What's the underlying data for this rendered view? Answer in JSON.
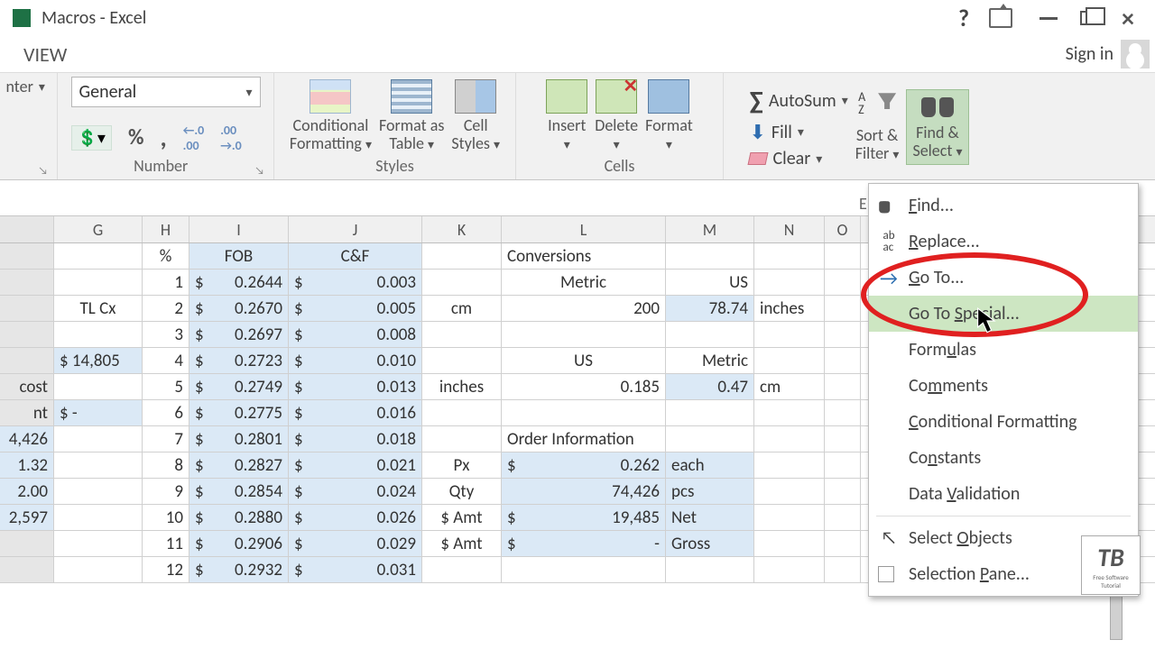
{
  "title": "Macros - Excel",
  "tabs": {
    "view": "VIEW"
  },
  "signin": "Sign in",
  "ribbon": {
    "align_stub": "nter",
    "number": {
      "combo": "General",
      "group_label": "Number",
      "pct": "%",
      "comma": ",",
      "dec_inc": ".0₀₀",
      "dec_dec": ".00₃"
    },
    "styles": {
      "cond": "Conditional\nFormatting",
      "fmt_table": "Format as\nTable",
      "cell_styles": "Cell\nStyles",
      "group_label": "Styles"
    },
    "cells": {
      "insert": "Insert",
      "delete": "Delete",
      "format": "Format",
      "group_label": "Cells"
    },
    "editing": {
      "autosum": "AutoSum",
      "fill": "Fill",
      "clear": "Clear",
      "sort_filter": "Sort &\nFilter",
      "find_select": "Find &\nSelect",
      "group_label_frag": "E"
    }
  },
  "menu": {
    "find": "Find...",
    "replace": "Replace...",
    "goto": "Go To...",
    "gotospecial": "Go To Special...",
    "formulas": "Formulas",
    "comments": "Comments",
    "condfmt": "Conditional Formatting",
    "constants": "Constants",
    "datavalid": "Data Validation",
    "selectobj": "Select Objects",
    "selpane": "Selection Pane..."
  },
  "cols": {
    "G": "G",
    "H": "H",
    "I": "I",
    "J": "J",
    "K": "K",
    "L": "L",
    "M": "M",
    "N": "N",
    "O": "O"
  },
  "sheet": {
    "hdr": {
      "H": "%",
      "I": "FOB",
      "J": "C&F",
      "L": "Conversions"
    },
    "rows": [
      {
        "F": "",
        "G": "",
        "H": "1",
        "I_s": "$",
        "I": "0.2644",
        "J_s": "$",
        "J": "0.003",
        "K": "",
        "L": "Metric",
        "M": "US",
        "N": ""
      },
      {
        "F": "",
        "G": "TL Cx",
        "H": "2",
        "I_s": "$",
        "I": "0.2670",
        "J_s": "$",
        "J": "0.005",
        "K": "cm",
        "L": "200",
        "M": "78.74",
        "N": "inches"
      },
      {
        "F": "",
        "G": "",
        "H": "3",
        "I_s": "$",
        "I": "0.2697",
        "J_s": "$",
        "J": "0.008",
        "K": "",
        "L": "",
        "M": "",
        "N": ""
      },
      {
        "F": "",
        "G": "$ 14,805",
        "H": "4",
        "I_s": "$",
        "I": "0.2723",
        "J_s": "$",
        "J": "0.010",
        "K": "",
        "L": "US",
        "M": "Metric",
        "N": ""
      },
      {
        "F": "cost",
        "G": "",
        "H": "5",
        "I_s": "$",
        "I": "0.2749",
        "J_s": "$",
        "J": "0.013",
        "K": "inches",
        "L": "0.185",
        "M": "0.47",
        "N": "cm"
      },
      {
        "F": "nt",
        "G": "$       -",
        "H": "6",
        "I_s": "$",
        "I": "0.2775",
        "J_s": "$",
        "J": "0.016",
        "K": "",
        "L": "",
        "M": "",
        "N": ""
      },
      {
        "F": "4,426",
        "G": "",
        "H": "7",
        "I_s": "$",
        "I": "0.2801",
        "J_s": "$",
        "J": "0.018",
        "K": "",
        "L": "Order Information",
        "M": "",
        "N": ""
      },
      {
        "F": "1.32",
        "G": "",
        "H": "8",
        "I_s": "$",
        "I": "0.2827",
        "J_s": "$",
        "J": "0.021",
        "K": "Px",
        "L_s": "$",
        "L": "0.262",
        "M": "each",
        "N": ""
      },
      {
        "F": "2.00",
        "G": "",
        "H": "9",
        "I_s": "$",
        "I": "0.2854",
        "J_s": "$",
        "J": "0.024",
        "K": "Qty",
        "L": "74,426",
        "M": "pcs",
        "N": ""
      },
      {
        "F": "2,597",
        "G": "",
        "H": "10",
        "I_s": "$",
        "I": "0.2880",
        "J_s": "$",
        "J": "0.026",
        "K": "$ Amt",
        "L_s": "$",
        "L": "19,485",
        "M": "Net",
        "N": ""
      },
      {
        "F": "",
        "G": "",
        "H": "11",
        "I_s": "$",
        "I": "0.2906",
        "J_s": "$",
        "J": "0.029",
        "K": "$ Amt",
        "L_s": "$",
        "L": "-",
        "M": "Gross",
        "N": ""
      },
      {
        "F": "",
        "G": "",
        "H": "12",
        "I_s": "$",
        "I": "0.2932",
        "J_s": "$",
        "J": "0.031",
        "K": "",
        "L": "",
        "M": "",
        "N": ""
      }
    ]
  },
  "tb": {
    "logo": "TB",
    "sub": "Free Software\nTutorial"
  }
}
